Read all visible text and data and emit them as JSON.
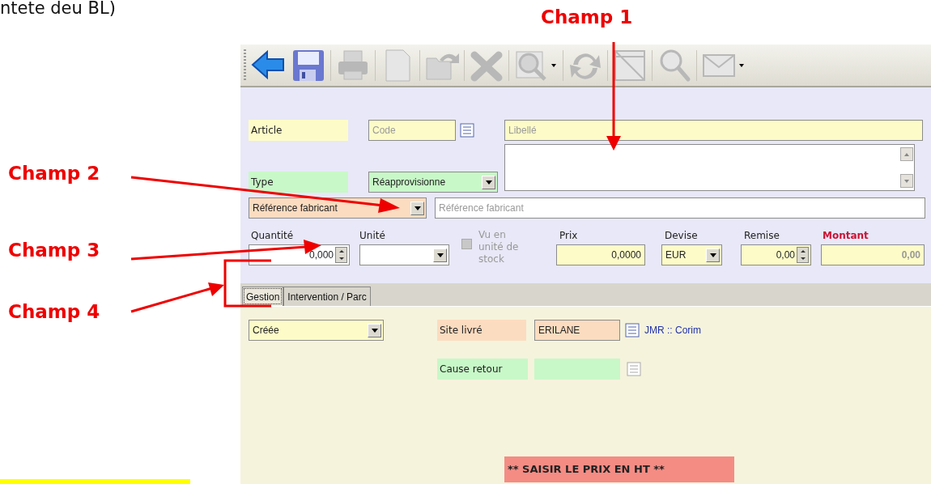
{
  "page_heading": "ntete deu BL)",
  "annotations": [
    {
      "label": "Champ 1"
    },
    {
      "label": "Champ 2"
    },
    {
      "label": "Champ 3"
    },
    {
      "label": "Champ 4"
    }
  ],
  "toolbar": {
    "buttons": [
      {
        "kind": "back",
        "disabled": false,
        "dropdown": false
      },
      {
        "kind": "save",
        "disabled": false,
        "dropdown": false
      },
      {
        "kind": "print",
        "disabled": true,
        "dropdown": false
      },
      {
        "kind": "new",
        "disabled": true,
        "dropdown": false
      },
      {
        "kind": "open",
        "disabled": true,
        "dropdown": false
      },
      {
        "kind": "delete",
        "disabled": true,
        "dropdown": false
      },
      {
        "kind": "preview",
        "disabled": true,
        "dropdown": true
      },
      {
        "kind": "refresh",
        "disabled": true,
        "dropdown": false
      },
      {
        "kind": "grid",
        "disabled": true,
        "dropdown": false
      },
      {
        "kind": "search",
        "disabled": true,
        "dropdown": false
      },
      {
        "kind": "mail",
        "disabled": true,
        "dropdown": true
      }
    ]
  },
  "form": {
    "article_label": "Article",
    "code": {
      "placeholder": "Code"
    },
    "libelle": {
      "placeholder": "Libellé"
    },
    "type_label": "Type",
    "type_value": "Réapprovisionne",
    "reference_select": "Référence fabricant",
    "reference_field": {
      "placeholder": "Référence fabricant"
    },
    "quantity": {
      "label": "Quantité",
      "value": "0,000"
    },
    "unit": {
      "label": "Unité"
    },
    "stock_unit": {
      "label": "Vu en unité de stock",
      "checked": false,
      "disabled": true
    },
    "price": {
      "label": "Prix",
      "value": "0,0000"
    },
    "currency": {
      "label": "Devise",
      "value": "EUR"
    },
    "discount": {
      "label": "Remise",
      "value": "0,00"
    },
    "amount": {
      "label": "Montant",
      "value": "0,00"
    }
  },
  "tabs": [
    {
      "label": "Gestion",
      "selected": true
    },
    {
      "label": "Intervention / Parc",
      "selected": false
    }
  ],
  "panel": {
    "status": "Créée",
    "site_label": "Site livré",
    "site_value": "ERILANE",
    "site_link": "JMR :: Corim",
    "return_label": "Cause retour",
    "banner": "** SAISIR LE PRIX  EN HT **"
  }
}
